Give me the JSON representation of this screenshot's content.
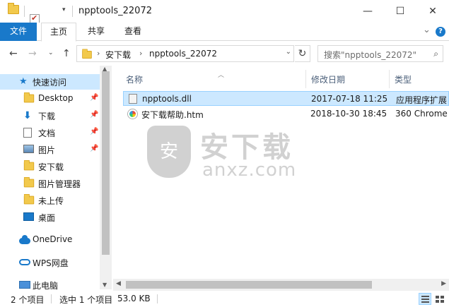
{
  "window": {
    "title": "npptools_22072",
    "controls": {
      "minimize": "—",
      "maximize": "☐",
      "close": "✕"
    }
  },
  "ribbon": {
    "tabs": [
      {
        "label": "文件"
      },
      {
        "label": "主页"
      },
      {
        "label": "共享"
      },
      {
        "label": "查看"
      }
    ],
    "expand_glyph": "⌄",
    "help_glyph": "?"
  },
  "address_bar": {
    "crumbs": [
      "安下载",
      "npptools_22072"
    ],
    "separator": "›",
    "search_placeholder": "搜索\"npptools_22072\""
  },
  "nav": {
    "quick_access": "快速访问",
    "pinned": [
      {
        "label": "Desktop",
        "icon": "folder-icon",
        "pinned": true
      },
      {
        "label": "下载",
        "icon": "download-icon",
        "pinned": true
      },
      {
        "label": "文档",
        "icon": "document-icon",
        "pinned": true
      },
      {
        "label": "图片",
        "icon": "pictures-icon",
        "pinned": true
      },
      {
        "label": "安下载",
        "icon": "folder-icon",
        "pinned": false
      },
      {
        "label": "图片管理器",
        "icon": "folder-icon",
        "pinned": false
      },
      {
        "label": "未上传",
        "icon": "folder-icon",
        "pinned": false
      },
      {
        "label": "桌面",
        "icon": "desktop-icon",
        "pinned": false
      }
    ],
    "onedrive": "OneDrive",
    "wps": "WPS网盘",
    "this_pc": "此电脑"
  },
  "columns": {
    "name": "名称",
    "modified": "修改日期",
    "type": "类型"
  },
  "files": [
    {
      "name": "npptools.dll",
      "modified": "2017-07-18 11:25",
      "type": "应用程序扩展",
      "icon": "dll-file-icon",
      "selected": true
    },
    {
      "name": "安下载帮助.htm",
      "modified": "2018-10-30 18:45",
      "type": "360 Chrome",
      "icon": "html-file-icon",
      "selected": false
    }
  ],
  "watermark": {
    "brand": "安下载",
    "domain": "anxz.com",
    "shield_char": "安"
  },
  "status": {
    "item_count": "2 个项目",
    "selected": "选中 1 个项目",
    "size": "53.0 KB"
  }
}
